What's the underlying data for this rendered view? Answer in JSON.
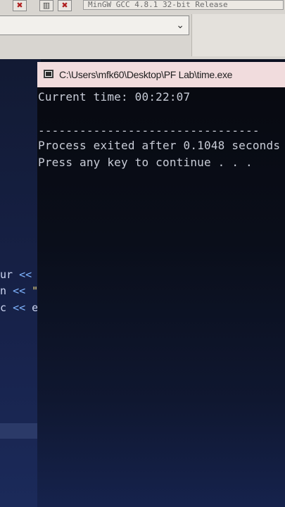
{
  "ide": {
    "compiler_label": "MinGW GCC 4.8.1 32-bit Release",
    "toolbar_icons": [
      "close-x-icon",
      "columns-icon",
      "delete-x-icon"
    ],
    "code_fragments": [
      {
        "text": "ur ",
        "op": "<<",
        "tail": ""
      },
      {
        "text": "n ",
        "op": "<<",
        "tail": " \""
      },
      {
        "text": "c ",
        "op": "<<",
        "tail": " e"
      }
    ]
  },
  "console": {
    "title": "C:\\Users\\mfk60\\Desktop\\PF Lab\\time.exe",
    "lines": {
      "current_time": "Current time: 00:22:07",
      "separator": "--------------------------------",
      "process_exited": "Process exited after 0.1048 seconds",
      "press_any_key": "Press any key to continue . . ."
    }
  },
  "colors": {
    "console_text": "#c9cdd8",
    "console_titlebar": "#f1dcdd",
    "ide_toolbar": "#d8d5d0"
  }
}
